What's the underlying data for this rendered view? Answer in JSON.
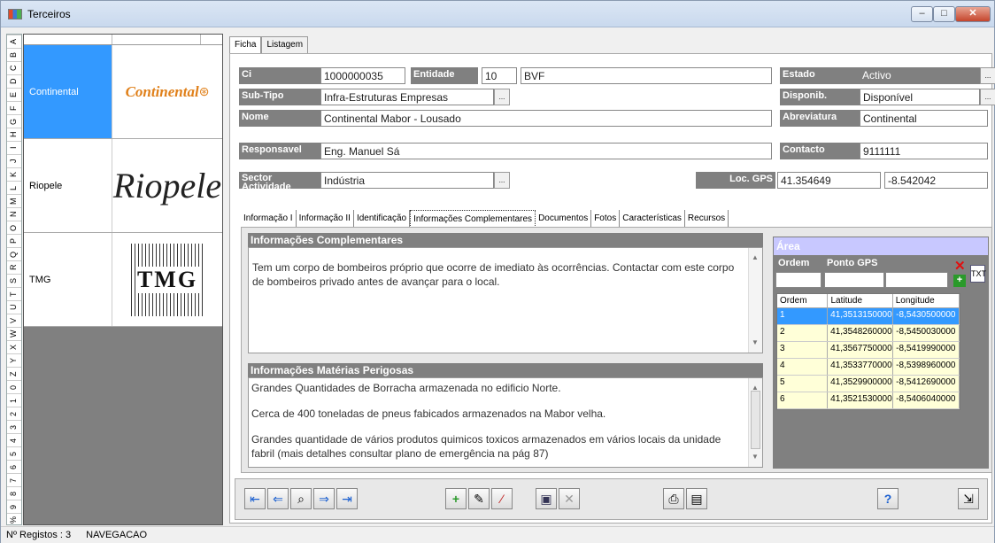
{
  "window": {
    "title": "Terceiros"
  },
  "alphabet": [
    "A",
    "B",
    "C",
    "D",
    "E",
    "F",
    "G",
    "H",
    "I",
    "J",
    "K",
    "L",
    "M",
    "N",
    "O",
    "P",
    "Q",
    "R",
    "S",
    "T",
    "U",
    "V",
    "W",
    "X",
    "Y",
    "Z",
    "0",
    "1",
    "2",
    "3",
    "4",
    "5",
    "6",
    "7",
    "8",
    "9",
    "%"
  ],
  "list": {
    "rows": [
      {
        "name": "Continental",
        "logo_text": "Continental"
      },
      {
        "name": "Riopele",
        "logo_text": "Riopele"
      },
      {
        "name": "TMG",
        "logo_text": "TMG"
      }
    ]
  },
  "tabs": {
    "ficha": "Ficha",
    "listagem": "Listagem"
  },
  "form": {
    "ci_label": "Ci",
    "ci": "1000000035",
    "entidade_label": "Entidade",
    "entidade": "10",
    "entidade_name": "BVF",
    "estado_label": "Estado",
    "estado": "Activo",
    "subtipo_label": "Sub-Tipo",
    "subtipo": "Infra-Estruturas Empresas",
    "disponib_label": "Disponib.",
    "disponib": "Disponível",
    "nome_label": "Nome",
    "nome": "Continental Mabor - Lousado",
    "abrev_label": "Abreviatura",
    "abrev": "Continental",
    "resp_label": "Responsavel",
    "resp": "Eng. Manuel Sá",
    "contacto_label": "Contacto",
    "contacto": "9111111",
    "sector_label": "Sector Actividade",
    "sector": "Indústria",
    "gps_label": "Loc. GPS",
    "gps_lat": "41.354649",
    "gps_lon": "-8.542042"
  },
  "inner_tabs": [
    "Informação I",
    "Informação II",
    "Identificação",
    "Informações Complementares",
    "Documentos",
    "Fotos",
    "Características",
    "Recursos"
  ],
  "info_comp": {
    "title": "Informações Complementares",
    "text": "Tem um corpo de bombeiros próprio que ocorre de imediato às ocorrências. Contactar com este corpo de bombeiros privado antes de avançar para o local."
  },
  "info_mat": {
    "title": "Informações Matérias Perigosas",
    "lines": [
      "Grandes Quantidades de Borracha armazenada no edificio Norte.",
      "Cerca de 400 toneladas de pneus fabicados armazenados na Mabor velha.",
      "Grandes quantidade de vários produtos quimicos toxicos armazenados em vários locais da unidade fabril (mais detalhes consultar plano de emergência na pág 87)"
    ]
  },
  "area": {
    "title": "Área",
    "ordem_label": "Ordem",
    "ponto_label": "Ponto GPS",
    "headers": [
      "Ordem",
      "Latitude",
      "Longitude"
    ],
    "rows": [
      [
        "1",
        "41,3513150000",
        "-8,5430500000"
      ],
      [
        "2",
        "41,3548260000",
        "-8,5450030000"
      ],
      [
        "3",
        "41,3567750000",
        "-8,5419990000"
      ],
      [
        "4",
        "41,3533770000",
        "-8,5398960000"
      ],
      [
        "5",
        "41,3529900000",
        "-8,5412690000"
      ],
      [
        "6",
        "41,3521530000",
        "-8,5406040000"
      ]
    ]
  },
  "status": {
    "registos": "Nº Registos : 3",
    "mode": "NAVEGACAO"
  }
}
